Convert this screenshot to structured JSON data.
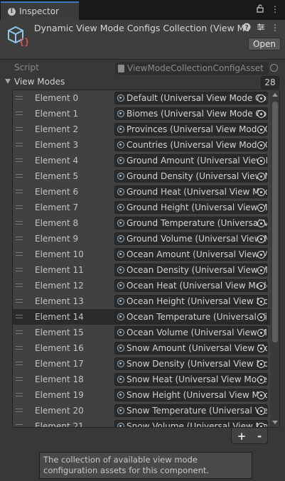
{
  "tab": {
    "title": "Inspector",
    "icon": "info-icon"
  },
  "tab_controls": {
    "lock_icon": "lock-icon",
    "menu_icon": "kebab-menu-icon"
  },
  "header": {
    "title": "Dynamic View Mode Configs Collection (View Mode Collection Config)",
    "open_label": "Open",
    "asset_icon": "scriptable-object-icon",
    "help_icon": "help-icon",
    "settings_icon": "presets-icon",
    "menu_icon": "kebab-menu-icon"
  },
  "script": {
    "label": "Script",
    "value": "ViewModeCollectionConfigAsset"
  },
  "view_modes": {
    "label": "View Modes",
    "count": "28",
    "elements": [
      {
        "label": "Element 0",
        "value": "Default (Universal View Mode Config)"
      },
      {
        "label": "Element 1",
        "value": "Biomes (Universal View Mode Config)"
      },
      {
        "label": "Element 2",
        "value": "Provinces (Universal View Mode Config)"
      },
      {
        "label": "Element 3",
        "value": "Countries (Universal View Mode Config)"
      },
      {
        "label": "Element 4",
        "value": "Ground Amount (Universal View Mode Config)"
      },
      {
        "label": "Element 5",
        "value": "Ground Density (Universal View Mode Config)"
      },
      {
        "label": "Element 6",
        "value": "Ground Heat (Universal View Mode Config)"
      },
      {
        "label": "Element 7",
        "value": "Ground Height (Universal View Mode Config)"
      },
      {
        "label": "Element 8",
        "value": "Ground Temperature (Universal View Mode Config)"
      },
      {
        "label": "Element 9",
        "value": "Ground Volume (Universal View Mode Config)"
      },
      {
        "label": "Element 10",
        "value": "Ocean Amount (Universal View Mode Config)"
      },
      {
        "label": "Element 11",
        "value": "Ocean Density (Universal View Mode Config)"
      },
      {
        "label": "Element 12",
        "value": "Ocean Heat (Universal View Mode Config)"
      },
      {
        "label": "Element 13",
        "value": "Ocean Height (Universal View Mode Config)"
      },
      {
        "label": "Element 14",
        "value": "Ocean Temperature (Universal View Mode Config)"
      },
      {
        "label": "Element 15",
        "value": "Ocean Volume (Universal View Mode Config)"
      },
      {
        "label": "Element 16",
        "value": "Snow Amount (Universal View Mode Config)"
      },
      {
        "label": "Element 17",
        "value": "Snow Density (Universal View Mode Config)"
      },
      {
        "label": "Element 18",
        "value": "Snow Heat (Universal View Mode Config)"
      },
      {
        "label": "Element 19",
        "value": "Snow Height (Universal View Mode Config)"
      },
      {
        "label": "Element 20",
        "value": "Snow Temperature (Universal View Mode Config)"
      },
      {
        "label": "Element 21",
        "value": "Snow Volume (Universal View Mode Config)"
      }
    ],
    "selected_index": 14,
    "add_label": "+",
    "remove_label": "-"
  },
  "tooltip": "The collection of available view mode configuration assets for this component.",
  "colors": {
    "background": "#383838",
    "tab_accent": "#3a79bb",
    "field_bg": "#2a2a2a",
    "selected_row": "#2b2b2b"
  }
}
